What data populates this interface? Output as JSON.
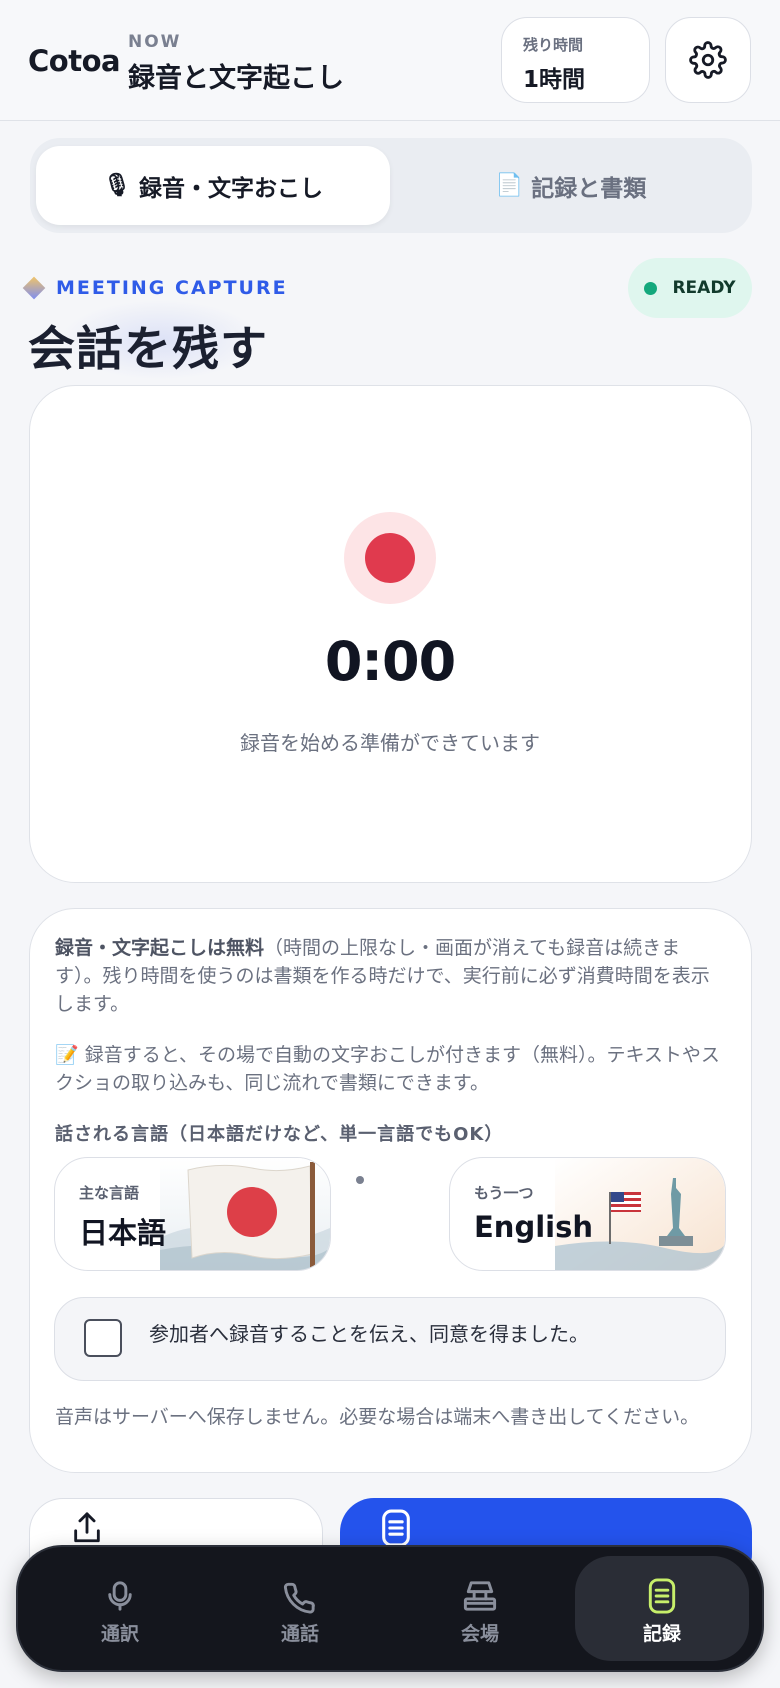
{
  "header": {
    "brand": "Cotoa",
    "now_label": "NOW",
    "now_title": "録音と文字起こし",
    "remaining_label": "残り時間",
    "remaining_value": "1時間",
    "settings_icon": "gear-icon"
  },
  "tabs": [
    {
      "icon": "🎙",
      "label": "録音・文字おこし",
      "active": true
    },
    {
      "icon": "📄",
      "label": "記録と書類",
      "active": false
    }
  ],
  "section": {
    "eyebrow": "MEETING CAPTURE",
    "title": "会話を残す",
    "status": "READY"
  },
  "recorder": {
    "timer": "0:00",
    "status_text": "録音を始める準備ができています",
    "record_color": "#e03a4e"
  },
  "info": {
    "p1_bold": "録音・文字起こしは無料",
    "p1_rest": "（時間の上限なし・画面が消えても録音は続きます）。残り時間を使うのは書類を作る時だけで、実行前に必ず消費時間を表示します。",
    "p2_icon": "📝",
    "p2_text": "録音すると、その場で自動の文字おこしが付きます（無料）。テキストやスクショの取り込みも、同じ流れで書類にできます。",
    "language_heading": "話される言語（日本語だけなど、単一言語でもOK）",
    "primary_language_label": "主な言語",
    "primary_language_value": "日本語",
    "secondary_language_label": "もう一つ",
    "secondary_language_value": "English",
    "consent_text": "参加者へ録音することを伝え、同意を得ました。",
    "consent_checked": false,
    "privacy_note": "音声はサーバーへ保存しません。必要な場合は端末へ書き出してください。"
  },
  "actions": {
    "export_icon": "share-upload-icon",
    "document_icon": "document-list-icon",
    "primary_color": "#2453ec"
  },
  "bottom_nav": [
    {
      "label": "通訳",
      "icon": "microphone-icon",
      "active": false
    },
    {
      "label": "通話",
      "icon": "phone-icon",
      "active": false
    },
    {
      "label": "会場",
      "icon": "venue-icon",
      "active": false
    },
    {
      "label": "記録",
      "icon": "document-list-icon",
      "active": true
    }
  ],
  "colors": {
    "accent_blue": "#2f5be8",
    "ready_green": "#14a87c",
    "active_nav_icon": "#c7ef6a"
  }
}
